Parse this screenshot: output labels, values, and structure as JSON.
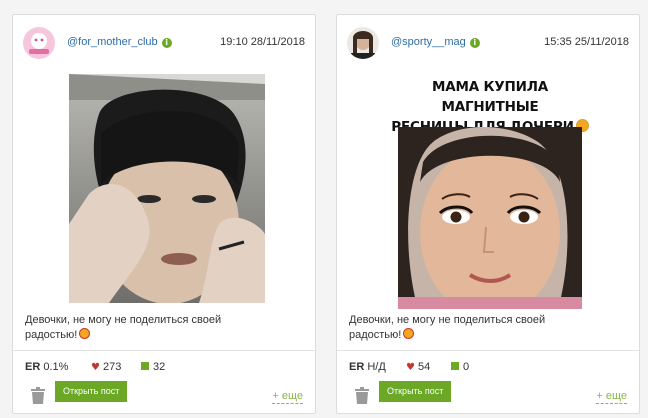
{
  "cards": [
    {
      "author": "@for_mother_club",
      "datetime": "19:10 28/11/2018",
      "caption": "Девочки, не могу не поделиться своей радостью!",
      "er_label": "ER",
      "er_value": "0.1%",
      "likes": "273",
      "comments": "32",
      "open_label": "Открыть пост",
      "more_label": "+ еще"
    },
    {
      "author": "@sporty__mag",
      "datetime": "15:35 25/11/2018",
      "meme_line1": "МАМА КУПИЛА МАГНИТНЫЕ",
      "meme_line2": "РЕСНИЦЫ ДЛЯ ДОЧЕРИ",
      "caption": "Девочки, не могу не поделиться своей радостью!",
      "er_label": "ER",
      "er_value": "Н/Д",
      "likes": "54",
      "comments": "0",
      "open_label": "Открыть пост",
      "more_label": "+ еще"
    }
  ],
  "icons": {
    "verified": "verified-badge-icon",
    "likes": "heart-icon",
    "comments": "comment-icon",
    "delete": "trash-icon"
  },
  "colors": {
    "link": "#2d6ea8",
    "accent": "#6aa825",
    "heart": "#c0392b"
  }
}
